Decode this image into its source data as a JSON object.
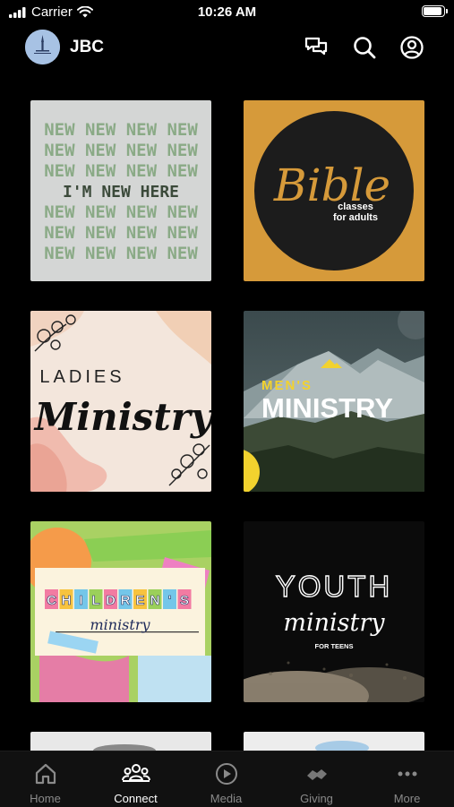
{
  "status_bar": {
    "carrier": "Carrier",
    "time": "10:26 AM",
    "battery_level": 1.0
  },
  "header": {
    "app_name": "JBC",
    "avatar_icon": "church-logo",
    "icons": [
      "chat-icon",
      "search-icon",
      "profile-icon"
    ]
  },
  "tiles": [
    {
      "name": "tile-im-new-here",
      "bg": "#d4d6d5",
      "repeat_text": "NEW NEW NEW NEW",
      "feature_text": "I'M NEW HERE",
      "colors": {
        "repeat": "#8aaa86",
        "feature": "#3b4a3a"
      }
    },
    {
      "name": "tile-bible-classes",
      "bg": "#d69a3a",
      "circle_color": "#1c1c1c",
      "script_text": "Bible",
      "sub_lines": [
        "classes",
        "for adults"
      ],
      "accent": "#d69a3a"
    },
    {
      "name": "tile-ladies-ministry",
      "bg": "#f3e6dc",
      "line1": "LADIES",
      "line2": "Ministry"
    },
    {
      "name": "tile-mens-ministry",
      "bg": "#2c3a3c",
      "line1": "MEN'S",
      "line2": "MINISTRY",
      "accent": "#f2d22e"
    },
    {
      "name": "tile-childrens-ministry",
      "bg": "#a9d163",
      "letters": [
        "C",
        "H",
        "I",
        "L",
        "D",
        "R",
        "E",
        "N",
        "'",
        "S"
      ],
      "letter_colors": [
        "#f27ba2",
        "#f7c33f",
        "#74c6e9",
        "#9bd05a",
        "#f27ba2",
        "#74c6e9",
        "#f7c33f",
        "#9bd05a",
        "#74c6e9",
        "#f27ba2"
      ],
      "subtitle": "ministry"
    },
    {
      "name": "tile-youth-ministry",
      "bg": "#0b0b0b",
      "line1": "YOUTH",
      "line2": "ministry",
      "line3": "FOR TEENS"
    }
  ],
  "tab_bar": {
    "active": "Connect",
    "tabs": [
      {
        "id": "home",
        "label": "Home",
        "icon": "home-icon"
      },
      {
        "id": "connect",
        "label": "Connect",
        "icon": "people-icon"
      },
      {
        "id": "media",
        "label": "Media",
        "icon": "play-icon"
      },
      {
        "id": "giving",
        "label": "Giving",
        "icon": "handshake-icon"
      },
      {
        "id": "more",
        "label": "More",
        "icon": "more-icon"
      }
    ]
  }
}
